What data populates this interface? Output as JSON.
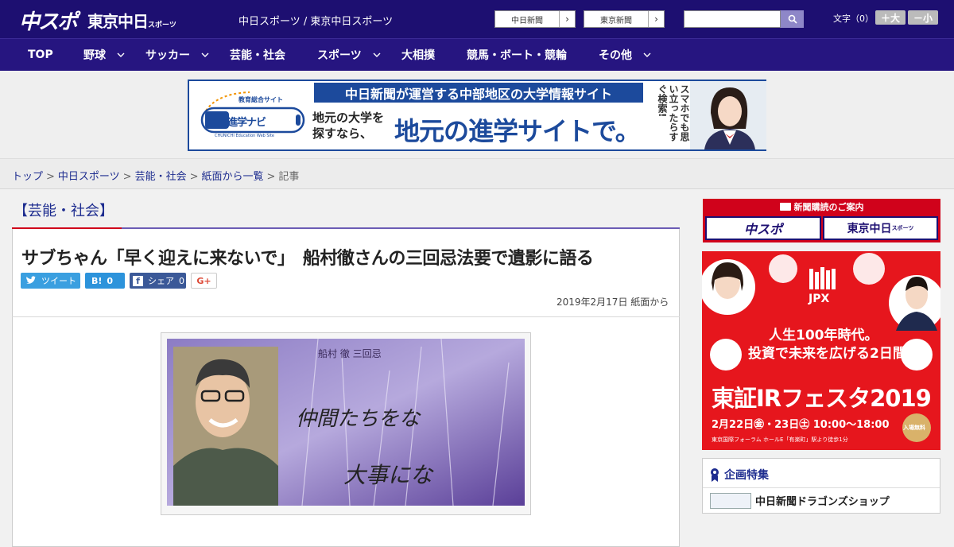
{
  "header": {
    "logo_chuspo": "中スポ",
    "logo_tokyo": "東京中日",
    "logo_tokyo_small": "スポーツ",
    "site_title": "中日スポーツ / 東京中日スポーツ",
    "site_links": [
      "中日新聞",
      "東京新聞"
    ],
    "search_placeholder": "",
    "fontsize_label": "文字（0）",
    "fontsize_plus": "＋大",
    "fontsize_minus": "－小"
  },
  "nav": {
    "items": [
      {
        "label": "TOP",
        "has_menu": false
      },
      {
        "label": "野球",
        "has_menu": true
      },
      {
        "label": "サッカー",
        "has_menu": true
      },
      {
        "label": "芸能・社会",
        "has_menu": false
      },
      {
        "label": "スポーツ",
        "has_menu": true
      },
      {
        "label": "大相撲",
        "has_menu": false
      },
      {
        "label": "競馬・ボート・競輪",
        "has_menu": false
      },
      {
        "label": "その他",
        "has_menu": true
      }
    ]
  },
  "banner": {
    "badge": "教育総合サイト",
    "logo_text": "中日進学ナビ",
    "logo_sub": "CHUNICHI Education Web Site",
    "headline": "中日新聞が運営する中部地区の大学情報サイト",
    "sub_line1": "地元の大学を",
    "sub_line2": "探すなら、",
    "big": "地元の進学サイトで。",
    "vertical": "スマホでも思い立ったらすぐ検索!"
  },
  "breadcrumb": {
    "items": [
      "トップ",
      "中日スポーツ",
      "芸能・社会",
      "紙面から一覧"
    ],
    "current": "記事"
  },
  "article": {
    "section": "【芸能・社会】",
    "title": "サブちゃん「早く迎えに来ないで」　船村徹さんの三回忌法要で遺影に語る",
    "share_tweet": "ツイート",
    "share_hatena": "B!",
    "share_hatena_count": "0",
    "share_fb": "シェア",
    "share_fb_count": "0",
    "share_gplus": "G+",
    "date": "2019年2月17日 紙面から",
    "photo_caption_top": "船村 徹 三回忌",
    "photo_line1": "仲間たちをな",
    "photo_line2": "大事にな"
  },
  "sidebar": {
    "subscribe_title": "新聞購読のご案内",
    "subscribe_chuspo": "中スポ",
    "subscribe_tokyo": "東京中日",
    "subscribe_tokyo_small": "スポーツ",
    "ad_brand": "JPX",
    "ad_line1": "人生100年時代。",
    "ad_line2": "投資で未来を広げる2日間。",
    "ad_title": "東証IRフェスタ2019",
    "ad_date": "2月22日㊎・23日㊏ 10:00～18:00",
    "ad_venue": "東京国際フォーラム ホールE「有楽町」駅より徒歩1分",
    "ad_free": "入場無料",
    "feature_title": "企画特集",
    "feature_item": "中日新聞ドラゴンズショップ"
  },
  "colors": {
    "header": "#1d0f71",
    "nav": "#261580",
    "link": "#1d2c8f",
    "accent_red": "#d0021b",
    "banner_blue": "#1c4a9c"
  }
}
